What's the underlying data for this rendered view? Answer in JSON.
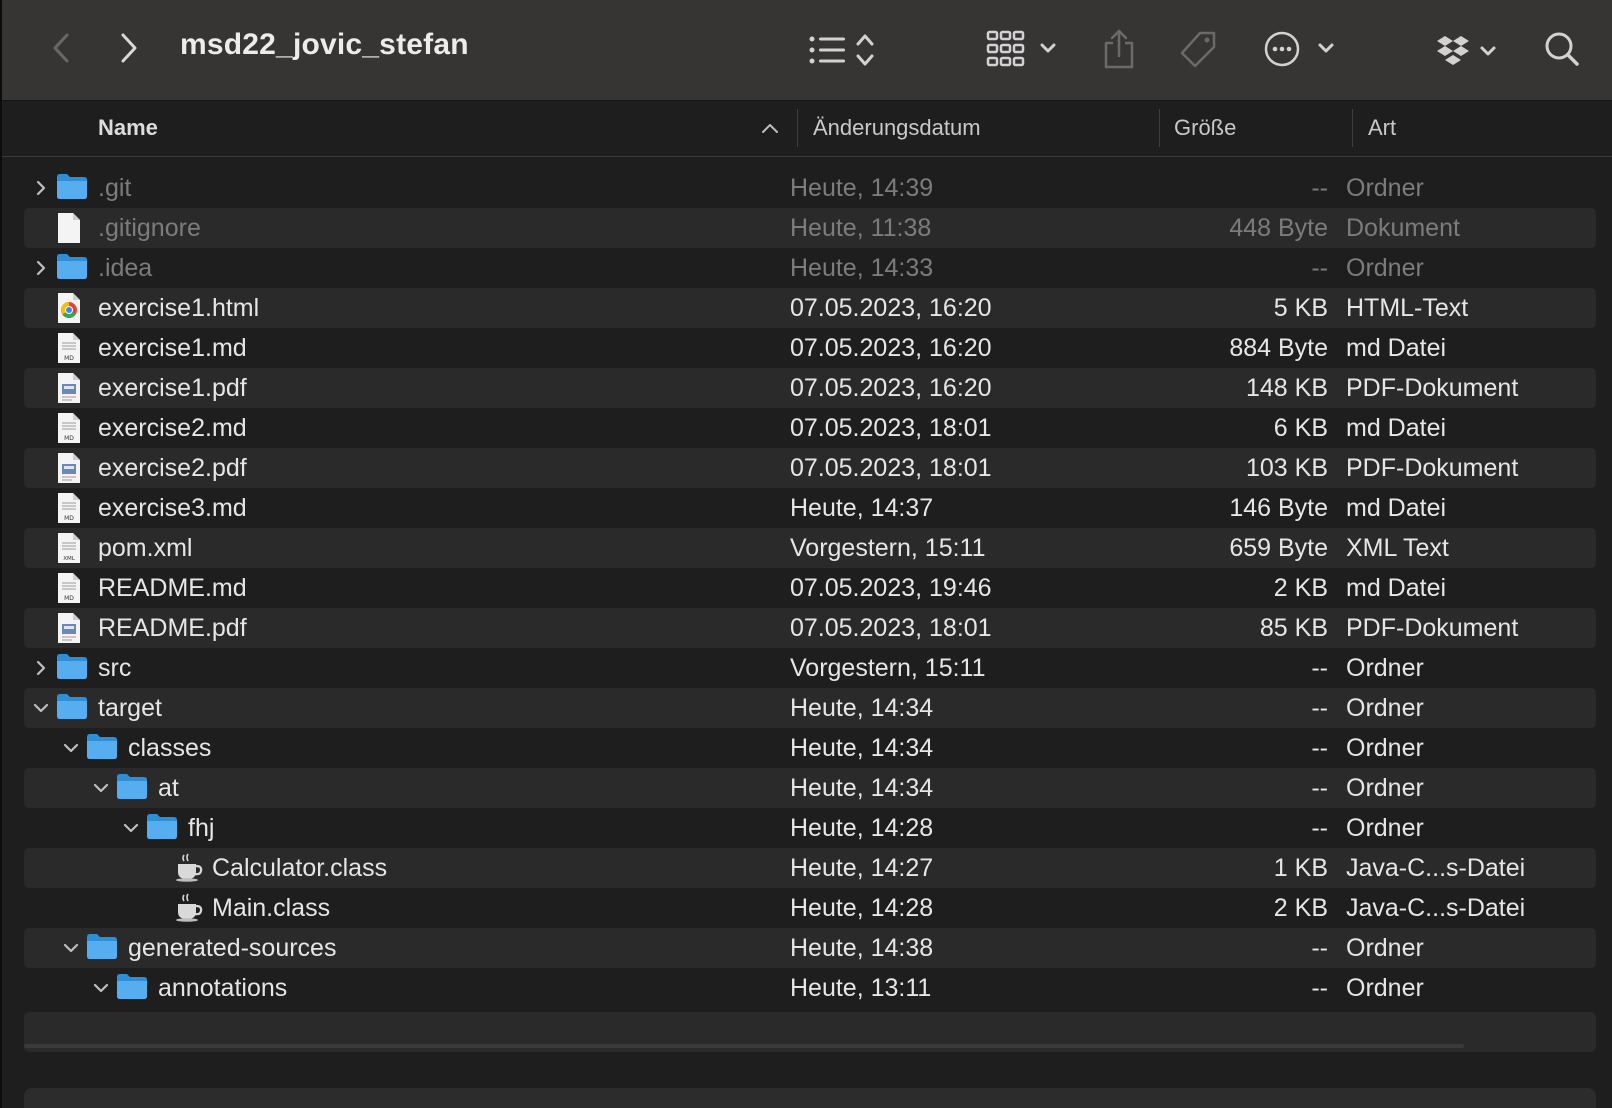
{
  "toolbar": {
    "title": "msd22_jovic_stefan",
    "icons": [
      "back-icon",
      "forward-icon",
      "list-view-icon",
      "grid-view-icon",
      "share-icon",
      "tag-icon",
      "more-icon",
      "dropbox-icon",
      "search-icon"
    ]
  },
  "columns": {
    "name": "Name",
    "date": "Änderungsdatum",
    "size": "Größe",
    "kind": "Art"
  },
  "rows": [
    {
      "name": ".git",
      "date": "Heute, 14:39",
      "size": "--",
      "kind": "Ordner",
      "type": "folder",
      "disclosure": "collapsed",
      "indent": 0,
      "dim": true
    },
    {
      "name": ".gitignore",
      "date": "Heute, 11:38",
      "size": "448 Byte",
      "kind": "Dokument",
      "type": "doc",
      "disclosure": "none",
      "indent": 0,
      "dim": true
    },
    {
      "name": ".idea",
      "date": "Heute, 14:33",
      "size": "--",
      "kind": "Ordner",
      "type": "folder",
      "disclosure": "collapsed",
      "indent": 0,
      "dim": true
    },
    {
      "name": "exercise1.html",
      "date": "07.05.2023, 16:20",
      "size": "5 KB",
      "kind": "HTML-Text",
      "type": "html",
      "disclosure": "none",
      "indent": 0
    },
    {
      "name": "exercise1.md",
      "date": "07.05.2023, 16:20",
      "size": "884 Byte",
      "kind": "md Datei",
      "type": "md",
      "disclosure": "none",
      "indent": 0
    },
    {
      "name": "exercise1.pdf",
      "date": "07.05.2023, 16:20",
      "size": "148 KB",
      "kind": "PDF-Dokument",
      "type": "pdf",
      "disclosure": "none",
      "indent": 0
    },
    {
      "name": "exercise2.md",
      "date": "07.05.2023, 18:01",
      "size": "6 KB",
      "kind": "md Datei",
      "type": "md",
      "disclosure": "none",
      "indent": 0
    },
    {
      "name": "exercise2.pdf",
      "date": "07.05.2023, 18:01",
      "size": "103 KB",
      "kind": "PDF-Dokument",
      "type": "pdf",
      "disclosure": "none",
      "indent": 0
    },
    {
      "name": "exercise3.md",
      "date": "Heute, 14:37",
      "size": "146 Byte",
      "kind": "md Datei",
      "type": "md",
      "disclosure": "none",
      "indent": 0
    },
    {
      "name": "pom.xml",
      "date": "Vorgestern, 15:11",
      "size": "659 Byte",
      "kind": "XML Text",
      "type": "xml",
      "disclosure": "none",
      "indent": 0
    },
    {
      "name": "README.md",
      "date": "07.05.2023, 19:46",
      "size": "2 KB",
      "kind": "md Datei",
      "type": "md",
      "disclosure": "none",
      "indent": 0
    },
    {
      "name": "README.pdf",
      "date": "07.05.2023, 18:01",
      "size": "85 KB",
      "kind": "PDF-Dokument",
      "type": "pdf",
      "disclosure": "none",
      "indent": 0
    },
    {
      "name": "src",
      "date": "Vorgestern, 15:11",
      "size": "--",
      "kind": "Ordner",
      "type": "folder",
      "disclosure": "collapsed",
      "indent": 0
    },
    {
      "name": "target",
      "date": "Heute, 14:34",
      "size": "--",
      "kind": "Ordner",
      "type": "folder",
      "disclosure": "expanded",
      "indent": 0
    },
    {
      "name": "classes",
      "date": "Heute, 14:34",
      "size": "--",
      "kind": "Ordner",
      "type": "folder",
      "disclosure": "expanded",
      "indent": 1
    },
    {
      "name": "at",
      "date": "Heute, 14:34",
      "size": "--",
      "kind": "Ordner",
      "type": "folder",
      "disclosure": "expanded",
      "indent": 2
    },
    {
      "name": "fhj",
      "date": "Heute, 14:28",
      "size": "--",
      "kind": "Ordner",
      "type": "folder",
      "disclosure": "expanded",
      "indent": 3
    },
    {
      "name": "Calculator.class",
      "date": "Heute, 14:27",
      "size": "1 KB",
      "kind": "Java-C...s-Datei",
      "type": "java",
      "disclosure": "none",
      "indent": 4
    },
    {
      "name": "Main.class",
      "date": "Heute, 14:28",
      "size": "2 KB",
      "kind": "Java-C...s-Datei",
      "type": "java",
      "disclosure": "none",
      "indent": 4
    },
    {
      "name": "generated-sources",
      "date": "Heute, 14:38",
      "size": "--",
      "kind": "Ordner",
      "type": "folder",
      "disclosure": "expanded",
      "indent": 1
    },
    {
      "name": "annotations",
      "date": "Heute, 13:11",
      "size": "--",
      "kind": "Ordner",
      "type": "folder",
      "disclosure": "expanded",
      "indent": 2
    }
  ]
}
